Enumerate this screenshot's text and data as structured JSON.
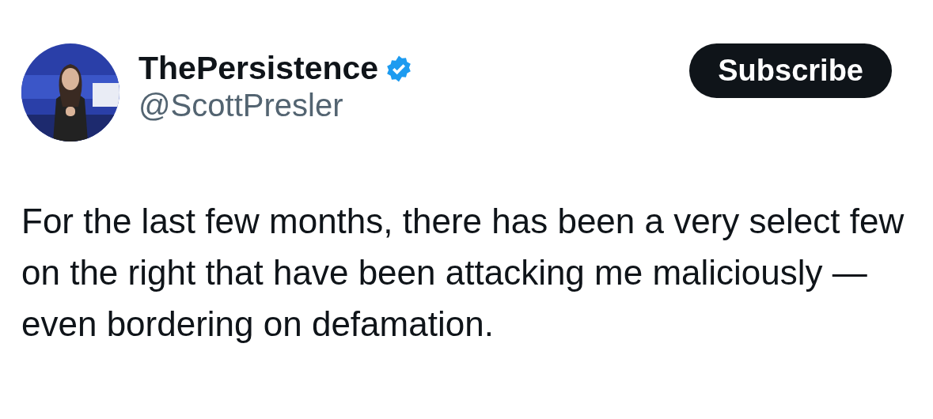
{
  "author": {
    "name": "ThePersistence",
    "verified": true,
    "handle": "@ScottPresler"
  },
  "subscribe_button": {
    "label": "Subscribe"
  },
  "body": "For the last few months, there has been a very select few on the right that have been attacking me maliciously — even bordering on defamation."
}
